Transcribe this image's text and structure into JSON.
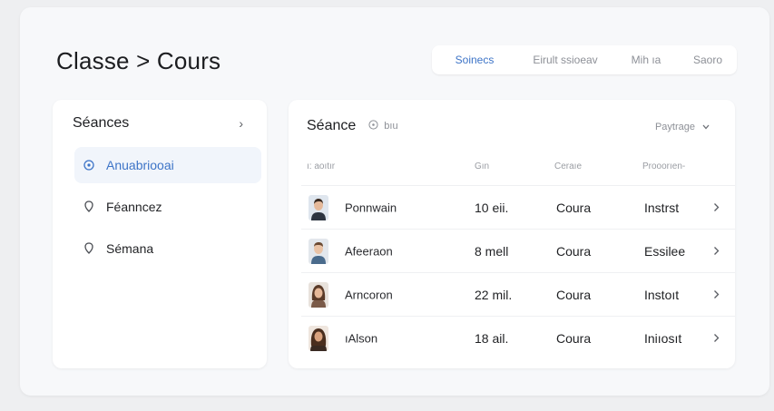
{
  "header": {
    "title": "Classe > Cours"
  },
  "tabs": [
    {
      "label": "Soinecs",
      "active": true
    },
    {
      "label": "Eirult ssioeav",
      "active": false
    },
    {
      "label": "Mih ıa",
      "active": false
    },
    {
      "label": "Saoro",
      "active": false
    }
  ],
  "sidebar": {
    "title": "Séances",
    "chevron": "›",
    "items": [
      {
        "label": "Anuabriooai",
        "icon": "clock-icon",
        "active": true
      },
      {
        "label": "Féanncez",
        "icon": "pin-icon",
        "active": false
      },
      {
        "label": "Sémana",
        "icon": "pin-icon",
        "active": false
      }
    ]
  },
  "panel": {
    "title": "Séance",
    "subtitle": "bıu",
    "sort_label": "Paytrage",
    "columns": [
      "ı: aoıtır",
      "Gın",
      "Ceraıe",
      "Prooorıen-"
    ],
    "rows": [
      {
        "name": "Ponnwain",
        "qty": "10 eii.",
        "course": "Coura",
        "status": "Instrst",
        "avatar": "male-1"
      },
      {
        "name": "Afeeraon",
        "qty": "8 mell",
        "course": "Coura",
        "status": "Essilee",
        "avatar": "male-2"
      },
      {
        "name": "Arncoron",
        "qty": "22 mil.",
        "course": "Coura",
        "status": "Instoıt",
        "avatar": "female-1"
      },
      {
        "name": "ıAlson",
        "qty": "18 ail.",
        "course": "Coura",
        "status": "Iniıosıt",
        "avatar": "female-2"
      }
    ]
  },
  "colors": {
    "accent": "#3d74c7",
    "background": "#eeeff1",
    "card": "#f7f8fa"
  }
}
